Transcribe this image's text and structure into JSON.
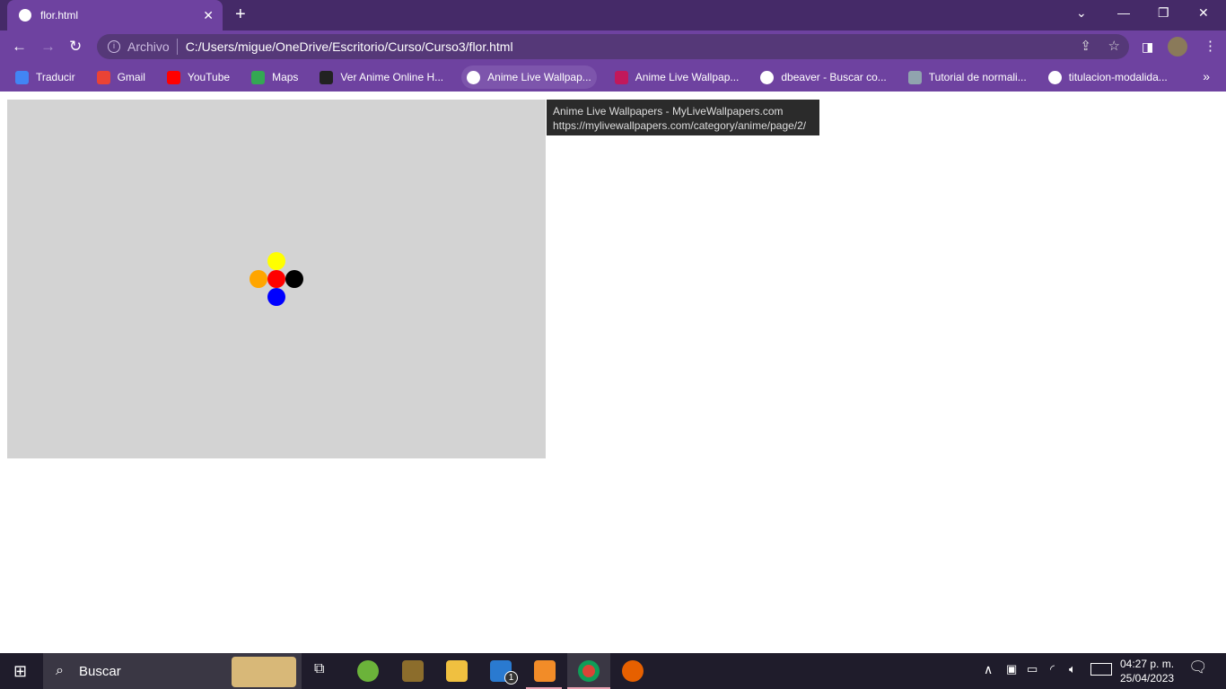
{
  "browser": {
    "tab": {
      "title": "flor.html",
      "icon": "globe-icon"
    },
    "address": {
      "scheme_label": "Archivo",
      "url": "C:/Users/migue/OneDrive/Escritorio/Curso/Curso3/flor.html"
    },
    "bookmarks": [
      {
        "label": "Traducir",
        "icon": "google-translate-icon",
        "color": "#4285f4"
      },
      {
        "label": "Gmail",
        "icon": "gmail-icon",
        "color": "#ea4335"
      },
      {
        "label": "YouTube",
        "icon": "youtube-icon",
        "color": "#ff0000"
      },
      {
        "label": "Maps",
        "icon": "maps-icon",
        "color": "#34a853"
      },
      {
        "label": "Ver Anime Online H...",
        "icon": "animeflv-icon",
        "color": "#222222"
      },
      {
        "label": "Anime Live Wallpap...",
        "icon": "globe-icon",
        "color": "#ffffff"
      },
      {
        "label": "Anime Live Wallpap...",
        "icon": "wallpaper-icon",
        "color": "#c2185b"
      },
      {
        "label": "dbeaver - Buscar co...",
        "icon": "google-icon",
        "color": "#ffffff"
      },
      {
        "label": "Tutorial de normali...",
        "icon": "site-icon",
        "color": "#90a4ae"
      },
      {
        "label": "titulacion-modalida...",
        "icon": "globe-icon",
        "color": "#ffffff"
      }
    ],
    "tooltip": {
      "title": "Anime Live Wallpapers - MyLiveWallpapers.com",
      "url": "https://mylivewallpapers.com/category/anime/page/2/"
    }
  },
  "page": {
    "canvas_bg": "#d3d3d3",
    "flower": [
      {
        "name": "petal-top",
        "color": "#ffff00"
      },
      {
        "name": "petal-left",
        "color": "#ffa500"
      },
      {
        "name": "center",
        "color": "#ff0000"
      },
      {
        "name": "petal-right",
        "color": "#000000"
      },
      {
        "name": "petal-bottom",
        "color": "#0000ff"
      }
    ]
  },
  "taskbar": {
    "search_placeholder": "Buscar",
    "time": "04:27 p. m.",
    "date": "25/04/2023",
    "mail_badge": "1"
  }
}
